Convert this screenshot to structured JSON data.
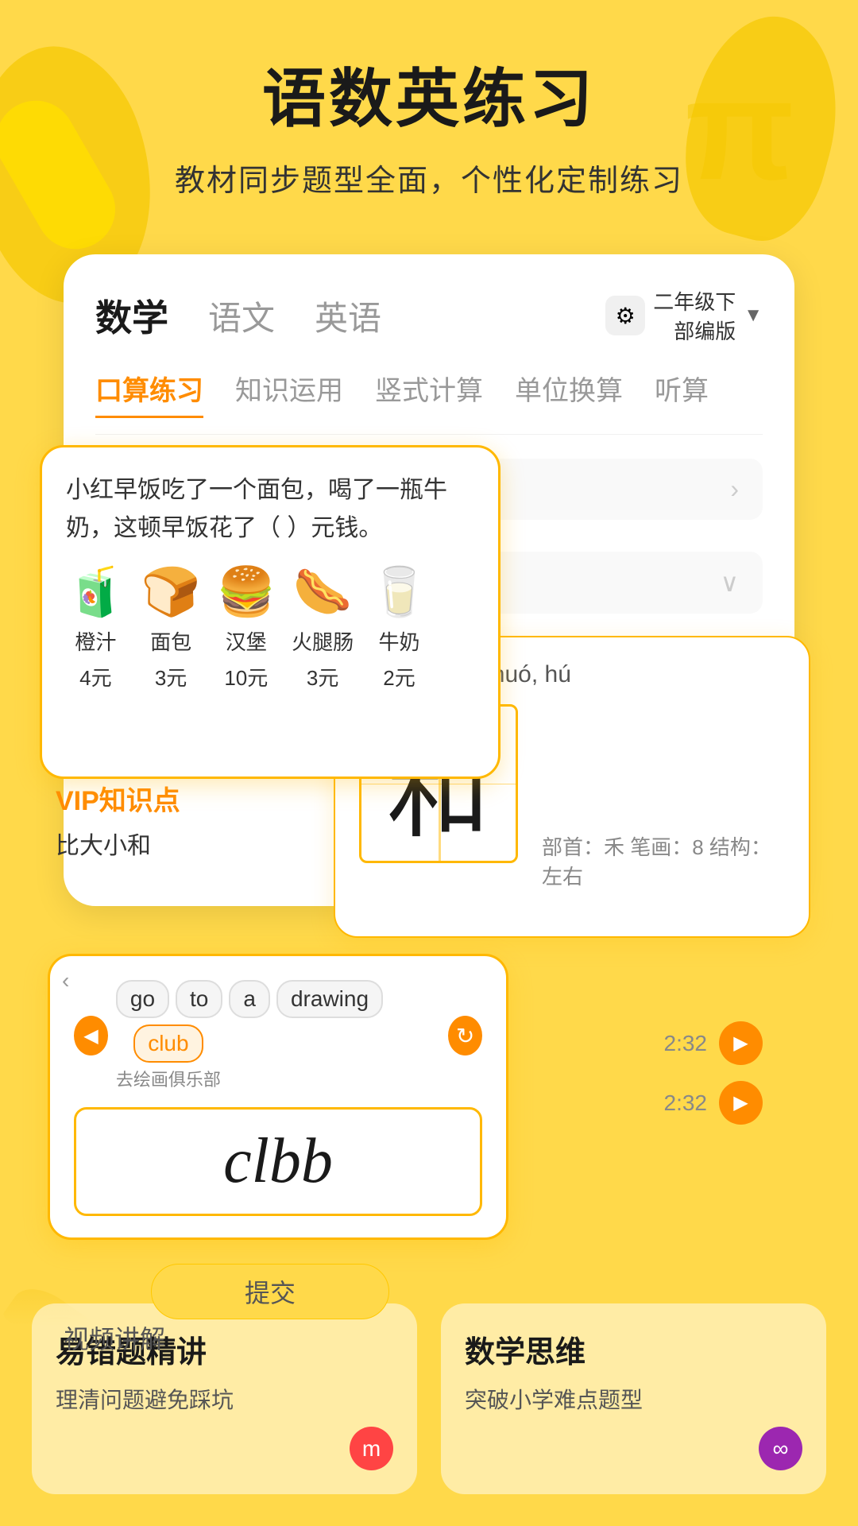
{
  "page": {
    "title": "语数英练习",
    "subtitle": "教材同步题型全面，个性化定制练习"
  },
  "tabs": {
    "main": [
      {
        "label": "数学",
        "active": true
      },
      {
        "label": "语文",
        "active": false
      },
      {
        "label": "英语",
        "active": false
      }
    ],
    "grade": "二年级下\n部编版",
    "subtabs": [
      {
        "label": "口算练习",
        "active": true
      },
      {
        "label": "知识运用",
        "active": false
      },
      {
        "label": "竖式计算",
        "active": false
      },
      {
        "label": "单位换算",
        "active": false
      },
      {
        "label": "听算",
        "active": false
      }
    ]
  },
  "math_problem": {
    "text": "小红早饭吃了一个面包，喝了一瓶牛奶，这顿早饭花了（ ）元钱。",
    "items": [
      {
        "emoji": "🧃",
        "name": "橙汁",
        "price": "4元"
      },
      {
        "emoji": "🍞",
        "name": "面包",
        "price": "3元"
      },
      {
        "emoji": "🍔",
        "name": "汉堡",
        "price": "10元"
      },
      {
        "emoji": "🌭",
        "name": "火腿肠",
        "price": "3元"
      },
      {
        "emoji": "🥛",
        "name": "牛奶",
        "price": "2元"
      }
    ]
  },
  "chinese": {
    "pinyin": "hé, hè, huó, huó, hú",
    "char": "和",
    "info": "部首：禾  笔画：8  结构：左右"
  },
  "vip": {
    "label": "VIP知识点",
    "sublabel": "比大小和"
  },
  "english": {
    "sentence_words": [
      "go",
      "to",
      "a",
      "drawing",
      "club"
    ],
    "highlighted_word": "club",
    "translation": "去绘画俱乐部",
    "answer": "clbb",
    "time1": "2:32",
    "time2": "2:32"
  },
  "submit": {
    "label": "提交"
  },
  "video_label": "视频讲解",
  "bottom": {
    "card1": {
      "title": "易错题精讲",
      "desc": "理清问题避免踩坑"
    },
    "card2": {
      "title": "数学思维",
      "desc": "突破小学难点题型"
    }
  }
}
